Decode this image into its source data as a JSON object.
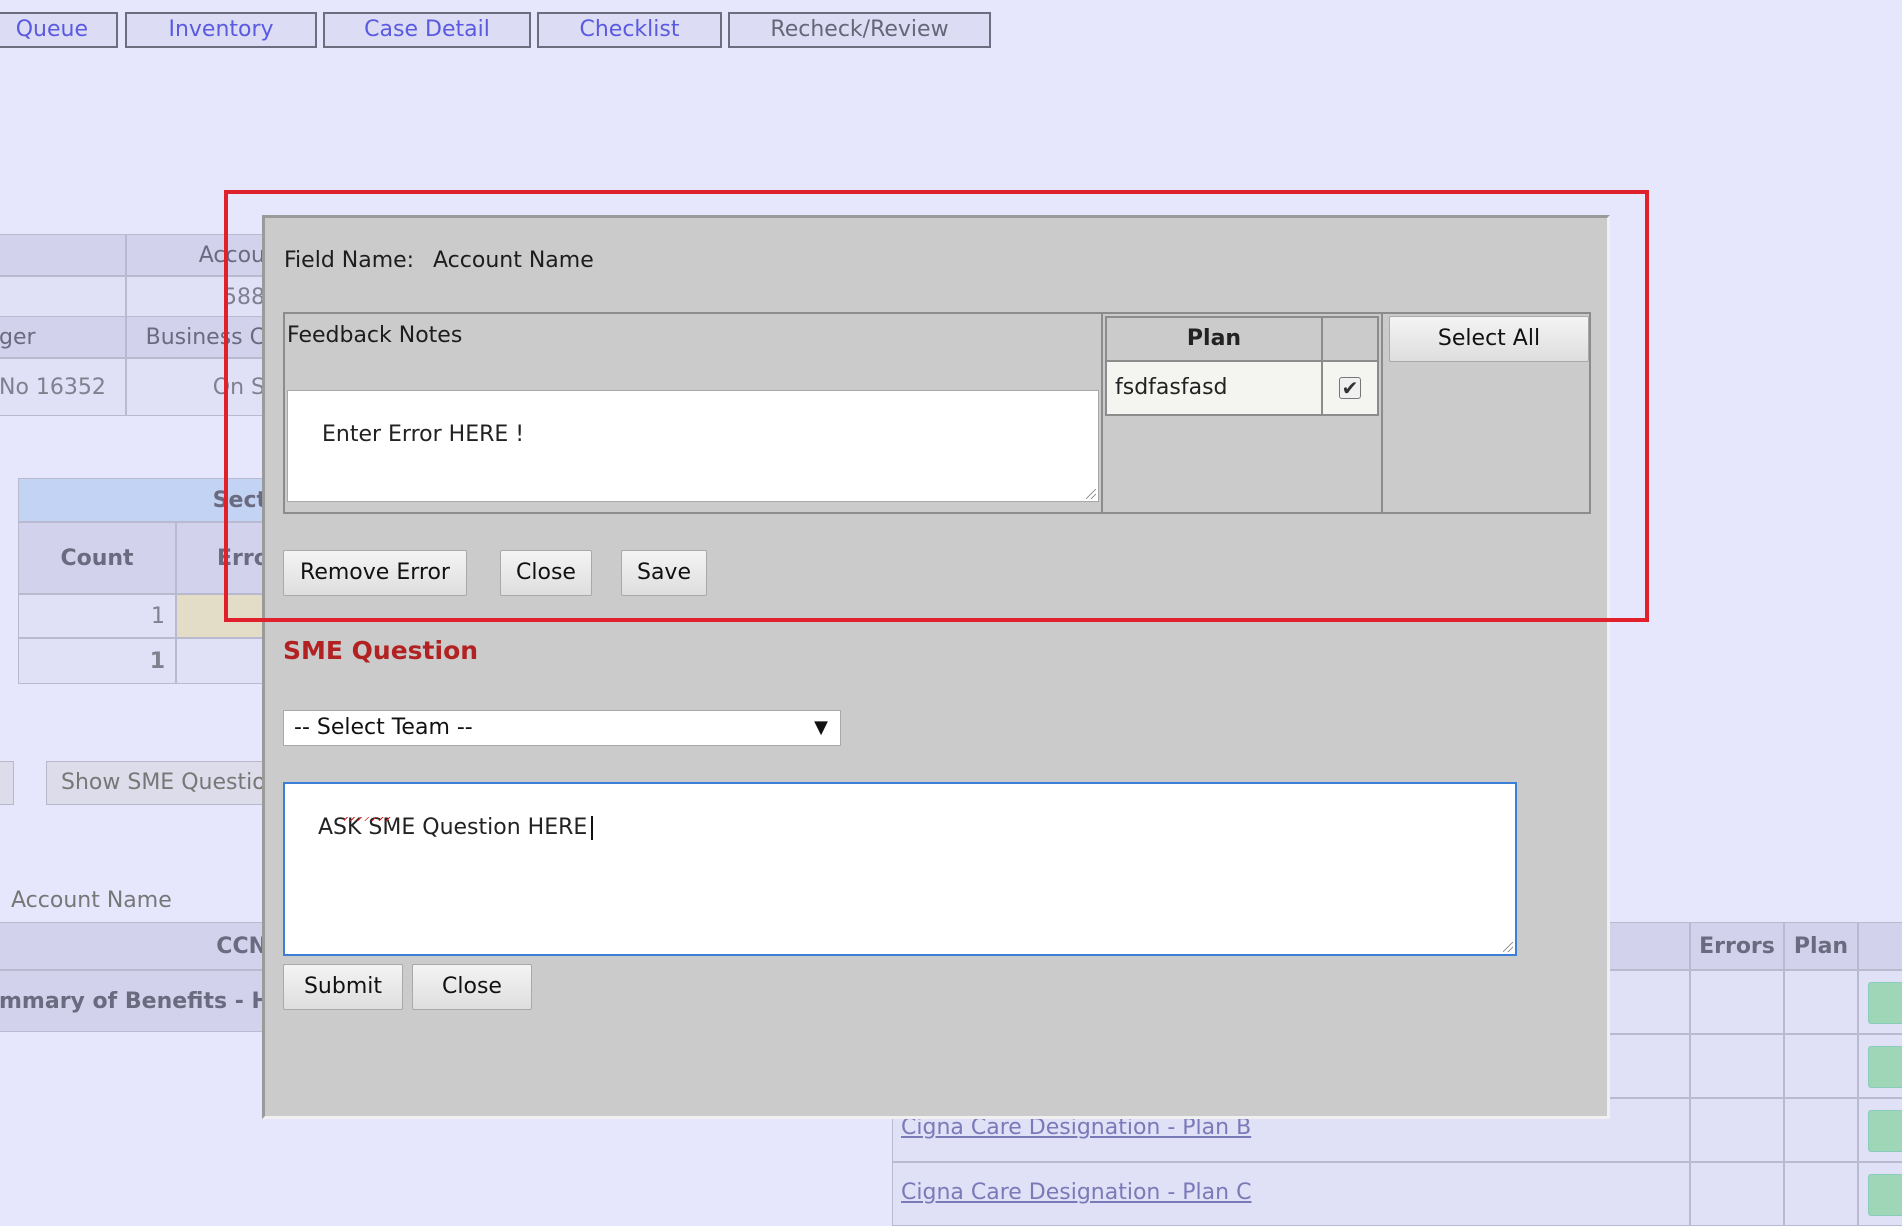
{
  "tabs": [
    {
      "label": "Queue"
    },
    {
      "label": "Inventory"
    },
    {
      "label": "Case Detail"
    },
    {
      "label": "Checklist"
    },
    {
      "label": "Recheck/Review"
    }
  ],
  "background": {
    "acct_header": "Accou",
    "acct_value": "588",
    "manager_label": "ger",
    "business_label": "Business C",
    "no_value": "No 16352",
    "on_value": "On S",
    "section_header": "Sect",
    "count_header": "Count",
    "errors_header": "Erro",
    "count_value_1": "1",
    "count_value_2": "1",
    "show_sme_button": "Show SME Questio",
    "account_name_label": "Account Name",
    "ccn_header": "CCN",
    "summary_row": "mmary of Benefits - H",
    "errors_col": "Errors",
    "plan_col": "Plan",
    "link_plan_b": "Cigna Care Designation - Plan B",
    "link_plan_c": "Cigna Care Designation - Plan C"
  },
  "modal": {
    "field_name_label": "Field Name:",
    "field_name_value": "Account Name",
    "feedback_notes_label": "Feedback Notes",
    "feedback_notes_value": "Enter Error HERE !",
    "plan_header": "Plan",
    "plan_rows": [
      {
        "name": "fsdfasfasd",
        "checked": true
      }
    ],
    "select_all_button": "Select All",
    "remove_error_button": "Remove Error",
    "close_button": "Close",
    "save_button": "Save",
    "sme_title": "SME Question",
    "team_select_value": "-- Select Team --",
    "sme_question_value": "ASK SME Question HERE",
    "submit_button": "Submit",
    "close_button_2": "Close",
    "checkmark": "✔",
    "caret": "▼"
  },
  "colors": {
    "page_bg": "#e6e6fd",
    "modal_bg": "#cbcbcb",
    "sme_title": "#b22222",
    "highlight": "#e0202a",
    "focus_border": "#3b7fd6"
  }
}
